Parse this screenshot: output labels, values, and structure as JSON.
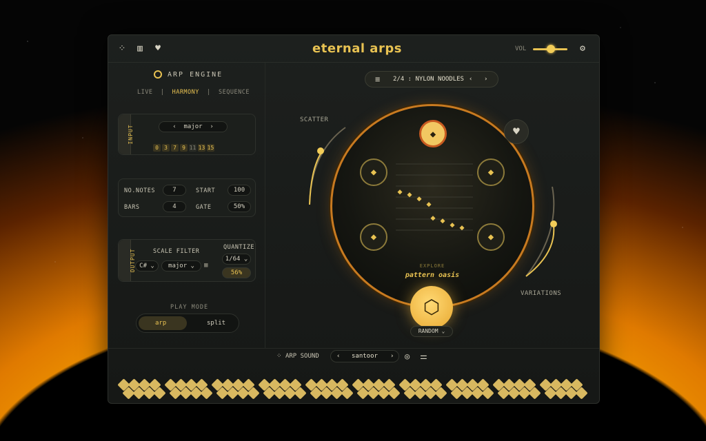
{
  "app": {
    "logo_text": "eternal arps",
    "vol_label": "VOL",
    "volume": 0.55
  },
  "engine": {
    "title": "ARP ENGINE",
    "modes": [
      "LIVE",
      "HARMONY",
      "SEQUENCE"
    ],
    "active_mode": "HARMONY"
  },
  "input": {
    "tab": "INPUT",
    "chord": "major",
    "chips": [
      "0",
      "3",
      "7",
      "9",
      "11",
      "13",
      "15"
    ],
    "active_chips": [
      "0",
      "3",
      "7",
      "9",
      "13",
      "15"
    ]
  },
  "params": {
    "notes_label": "NO.NOTES",
    "notes_val": "7",
    "start_label": "START",
    "start_val": "100",
    "bars_label": "BARS",
    "bars_val": "4",
    "gate_label": "GATE",
    "gate_val": "50%"
  },
  "output": {
    "tab": "OUTPUT",
    "scale_filter_label": "SCALE FILTER",
    "key": "C#",
    "scale": "major",
    "quantize_label": "QUANTIZE",
    "quantize_val": "1/64",
    "quantize_pct": "56%"
  },
  "play_mode": {
    "label": "PLAY MODE",
    "options": [
      "arp",
      "split"
    ],
    "active": "arp"
  },
  "preset": {
    "name": "2/4 : NYLON NOODLES"
  },
  "dial": {
    "scatter_label": "SCATTER",
    "variations_label": "VARIATIONS",
    "explore_label": "EXPLORE",
    "explore_value": "pattern oasis",
    "random_label": "RANDOM"
  },
  "sound": {
    "label": "ARP SOUND",
    "value": "santoor"
  },
  "colors": {
    "accent": "#e8c252",
    "orb_ring": "#c87a20"
  }
}
